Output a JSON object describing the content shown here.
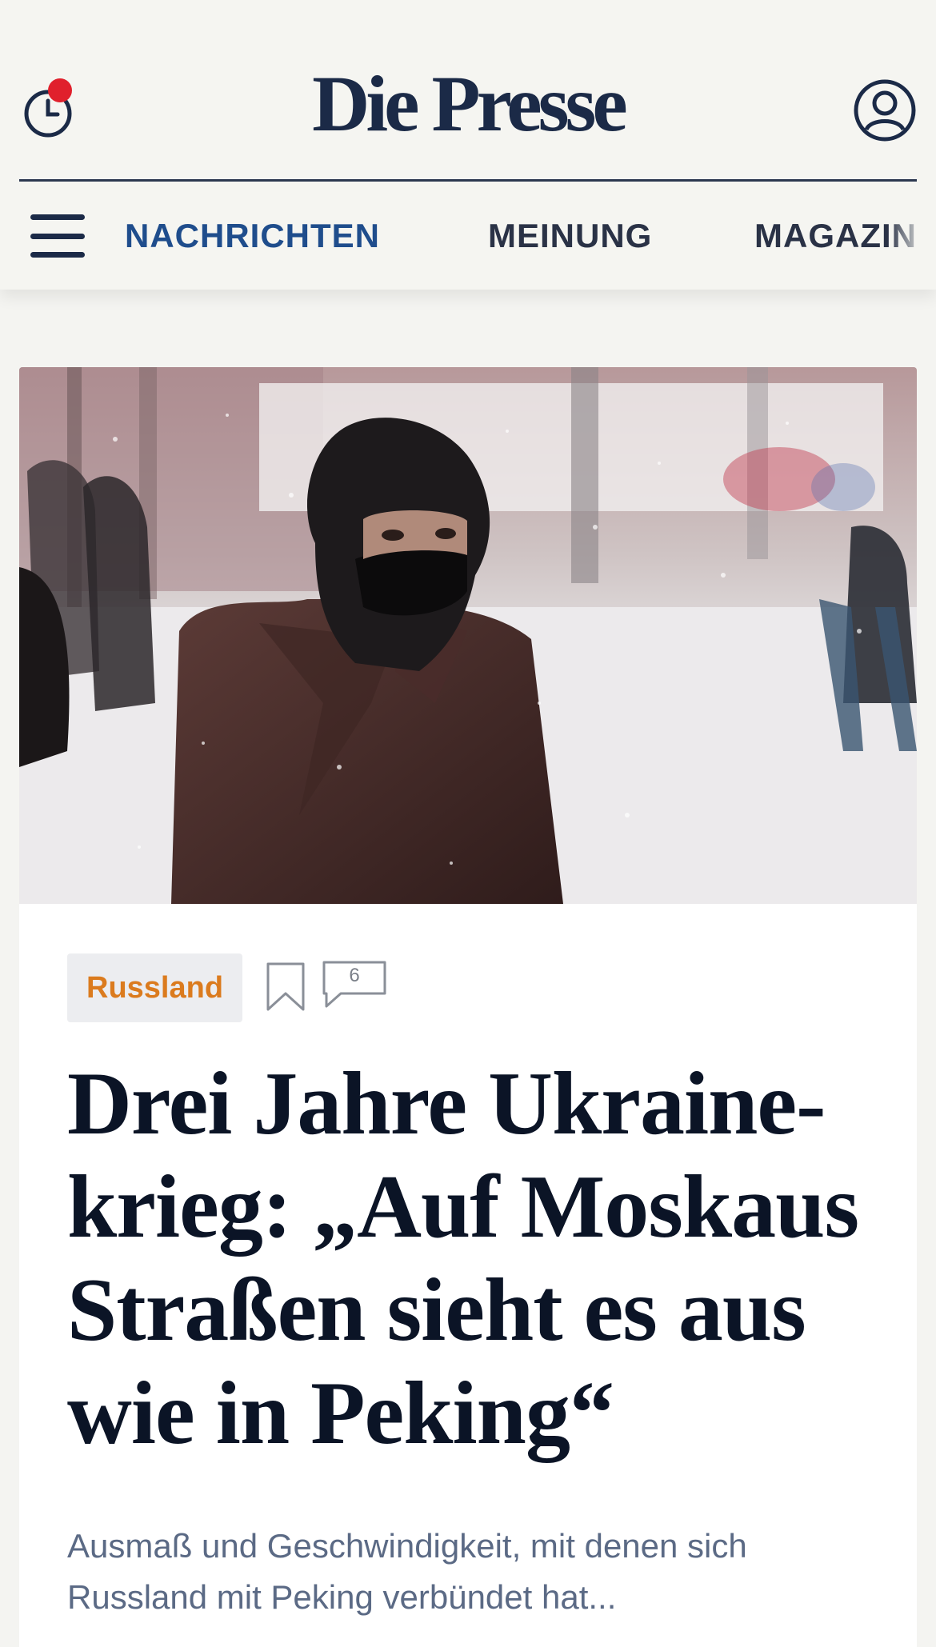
{
  "header": {
    "logo": "Die Presse",
    "history_icon": "clock-icon",
    "account_icon": "user-icon",
    "notification_color": "#e0202c"
  },
  "nav": {
    "items": [
      {
        "label": "NACHRICHTEN",
        "active": true
      },
      {
        "label": "MEINUNG",
        "active": false
      },
      {
        "label": "MAGAZIN",
        "active": false
      }
    ]
  },
  "article": {
    "category": "Russland",
    "comment_count": "6",
    "headline": "Drei Jahre Ukraine-krieg: „Auf Moskaus Straßen sieht es aus wie in Peking“",
    "teaser": "Ausmaß und Geschwindigkeit, mit denen sich Russland mit Peking verbündet hat..."
  },
  "colors": {
    "brand": "#1b2a47",
    "nav_active": "#1f4d8c",
    "category_text": "#db7b1e",
    "teaser_text": "#5b6a85"
  }
}
